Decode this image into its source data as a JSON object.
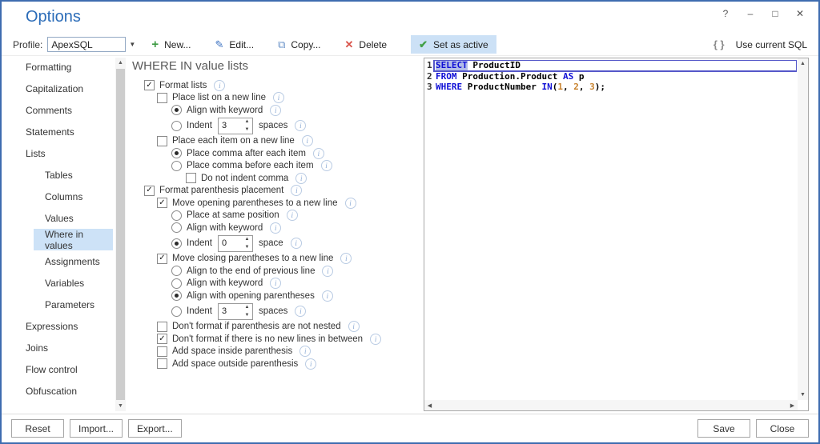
{
  "window": {
    "title": "Options",
    "controls": {
      "help": "?",
      "minimize": "–",
      "maximize": "□",
      "close": "✕"
    }
  },
  "toolbar": {
    "profile_label": "Profile:",
    "profile_value": "ApexSQL",
    "new_label": "New...",
    "edit_label": "Edit...",
    "copy_label": "Copy...",
    "delete_label": "Delete",
    "set_active_label": "Set as active",
    "braces_glyph": "{ }",
    "use_current_sql_label": "Use current SQL"
  },
  "sidebar": {
    "items": [
      {
        "label": "Formatting",
        "level": 0,
        "selected": false
      },
      {
        "label": "Capitalization",
        "level": 0,
        "selected": false
      },
      {
        "label": "Comments",
        "level": 0,
        "selected": false
      },
      {
        "label": "Statements",
        "level": 0,
        "selected": false
      },
      {
        "label": "Lists",
        "level": 0,
        "selected": false
      },
      {
        "label": "Tables",
        "level": 1,
        "selected": false
      },
      {
        "label": "Columns",
        "level": 1,
        "selected": false
      },
      {
        "label": "Values",
        "level": 1,
        "selected": false
      },
      {
        "label": "Where in values",
        "level": 1,
        "selected": true
      },
      {
        "label": "Assignments",
        "level": 1,
        "selected": false
      },
      {
        "label": "Variables",
        "level": 1,
        "selected": false
      },
      {
        "label": "Parameters",
        "level": 1,
        "selected": false
      },
      {
        "label": "Expressions",
        "level": 0,
        "selected": false
      },
      {
        "label": "Joins",
        "level": 0,
        "selected": false
      },
      {
        "label": "Flow control",
        "level": 0,
        "selected": false
      },
      {
        "label": "Obfuscation",
        "level": 0,
        "selected": false
      }
    ]
  },
  "options_panel": {
    "heading": "WHERE IN value lists",
    "items": [
      {
        "type": "checkbox",
        "checked": true,
        "indent": 0,
        "label": "Format lists",
        "info": true
      },
      {
        "type": "checkbox",
        "checked": false,
        "indent": 1,
        "label": "Place list on a new line",
        "info": true
      },
      {
        "type": "radio",
        "checked": true,
        "indent": 2,
        "label": "Align with keyword",
        "info": true
      },
      {
        "type": "radio",
        "checked": false,
        "indent": 2,
        "label": "Indent",
        "spinner_value": "3",
        "suffix": "spaces",
        "info": true
      },
      {
        "type": "checkbox",
        "checked": false,
        "indent": 1,
        "label": "Place each item on a new line",
        "info": true
      },
      {
        "type": "radio",
        "checked": true,
        "indent": 2,
        "label": "Place comma after each item",
        "info": true
      },
      {
        "type": "radio",
        "checked": false,
        "indent": 2,
        "label": "Place comma before each item",
        "info": true
      },
      {
        "type": "checkbox",
        "checked": false,
        "indent": 3,
        "label": "Do not indent comma",
        "info": true
      },
      {
        "type": "checkbox",
        "checked": true,
        "indent": 0,
        "label": "Format parenthesis placement",
        "info": true
      },
      {
        "type": "checkbox",
        "checked": true,
        "indent": 1,
        "label": "Move opening parentheses to a new line",
        "info": true
      },
      {
        "type": "radio",
        "checked": false,
        "indent": 2,
        "label": "Place at same position",
        "info": true
      },
      {
        "type": "radio",
        "checked": false,
        "indent": 2,
        "label": "Align with keyword",
        "info": true
      },
      {
        "type": "radio",
        "checked": true,
        "indent": 2,
        "label": "Indent",
        "spinner_value": "0",
        "suffix": "space",
        "info": true
      },
      {
        "type": "checkbox",
        "checked": true,
        "indent": 1,
        "label": "Move closing parentheses to a new line",
        "info": true
      },
      {
        "type": "radio",
        "checked": false,
        "indent": 2,
        "label": "Align to the end of previous line",
        "info": true
      },
      {
        "type": "radio",
        "checked": false,
        "indent": 2,
        "label": "Align with keyword",
        "info": true
      },
      {
        "type": "radio",
        "checked": true,
        "indent": 2,
        "label": "Align with opening parentheses",
        "info": true
      },
      {
        "type": "radio",
        "checked": false,
        "indent": 2,
        "label": "Indent",
        "spinner_value": "3",
        "suffix": "spaces",
        "info": true
      },
      {
        "type": "checkbox",
        "checked": false,
        "indent": 1,
        "label": "Don't format if parenthesis are not nested",
        "info": true
      },
      {
        "type": "checkbox",
        "checked": true,
        "indent": 1,
        "label": "Don't format if there is no new lines in between",
        "info": true
      },
      {
        "type": "checkbox",
        "checked": false,
        "indent": 1,
        "label": "Add space inside parenthesis",
        "info": true
      },
      {
        "type": "checkbox",
        "checked": false,
        "indent": 1,
        "label": "Add space outside parenthesis",
        "info": true
      }
    ]
  },
  "sql_panel": {
    "lines": [
      {
        "num": "1",
        "current": true,
        "tokens": [
          {
            "t": "kw",
            "s": "SELECT",
            "sel": true
          },
          {
            "t": "pl",
            "s": " ProductID"
          }
        ]
      },
      {
        "num": "2",
        "current": false,
        "tokens": [
          {
            "t": "kw",
            "s": "FROM"
          },
          {
            "t": "pl",
            "s": " Production.Product "
          },
          {
            "t": "kw",
            "s": "AS"
          },
          {
            "t": "pl",
            "s": " p"
          }
        ]
      },
      {
        "num": "3",
        "current": false,
        "tokens": [
          {
            "t": "kw",
            "s": "WHERE"
          },
          {
            "t": "pl",
            "s": " ProductNumber "
          },
          {
            "t": "kw",
            "s": "IN"
          },
          {
            "t": "pl",
            "s": "("
          },
          {
            "t": "num",
            "s": "1"
          },
          {
            "t": "pl",
            "s": ", "
          },
          {
            "t": "num",
            "s": "2"
          },
          {
            "t": "pl",
            "s": ", "
          },
          {
            "t": "num",
            "s": "3"
          },
          {
            "t": "pl",
            "s": ");"
          }
        ]
      }
    ]
  },
  "footer": {
    "reset_label": "Reset",
    "import_label": "Import...",
    "export_label": "Export...",
    "save_label": "Save",
    "close_label": "Close"
  },
  "colors": {
    "window_border": "#3e6cb0",
    "title_blue": "#2b6cb8",
    "selection_blue": "#cce1f6",
    "sql_keyword": "#0f0fd6",
    "sql_number": "#c8822d",
    "current_line_border": "#5457c9"
  }
}
